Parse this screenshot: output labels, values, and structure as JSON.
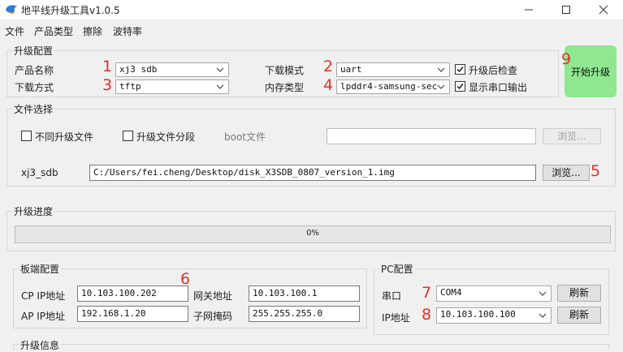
{
  "window": {
    "title": "地平线升级工具v1.0.5",
    "icon": "bird-logo-icon",
    "controls": [
      "minimize-icon",
      "maximize-icon",
      "close-icon"
    ]
  },
  "menu": [
    "文件",
    "产品类型",
    "擦除",
    "波特率"
  ],
  "upgrade_config": {
    "title": "升级配置",
    "product_label": "产品名称",
    "product_value": "xj3 sdb",
    "download_method_label": "下载方式",
    "download_method_value": "tftp",
    "download_mode_label": "下载模式",
    "download_mode_value": "uart",
    "memory_type_label": "内存类型",
    "memory_type_value": "lpddr4-samsung-sec",
    "check_after_label": "升级后检查",
    "check_after_checked": true,
    "show_serial_label": "显示串口输出",
    "show_serial_checked": true
  },
  "start_button": {
    "label": "开始升级",
    "color": "#8fe88f"
  },
  "file_select": {
    "title": "文件选择",
    "diff_files_label": "不同升级文件",
    "diff_files_checked": false,
    "segment_label": "升级文件分段",
    "segment_checked": false,
    "boot_label": "boot文件",
    "boot_path": "",
    "browse_label": "浏览...",
    "image_label": "xj3_sdb",
    "image_path": "C:/Users/fei.cheng/Desktop/disk_X3SDB_0807_version_1.img",
    "browse2_label": "浏览..."
  },
  "progress": {
    "title": "升级进度",
    "percent": 0,
    "text": "0%"
  },
  "board_config": {
    "title": "板端配置",
    "cp_ip_label": "CP IP地址",
    "cp_ip_value": "10.103.100.202",
    "gateway_label": "网关地址",
    "gateway_value": "10.103.100.1",
    "ap_ip_label": "AP IP地址",
    "ap_ip_value": "192.168.1.20",
    "netmask_label": "子网掩码",
    "netmask_value": "255.255.255.0"
  },
  "pc_config": {
    "title": "PC配置",
    "serial_label": "串口",
    "serial_value": "COM4",
    "refresh_label": "刷新",
    "ip_label": "IP地址",
    "ip_value": "10.103.100.100",
    "refresh2_label": "刷新"
  },
  "upgrade_info": {
    "title": "升级信息"
  },
  "annotations": [
    "1",
    "2",
    "3",
    "4",
    "5",
    "6",
    "7",
    "8",
    "9"
  ],
  "colors": {
    "annotation": "#e0322a",
    "progress_fill": "#06b025"
  }
}
